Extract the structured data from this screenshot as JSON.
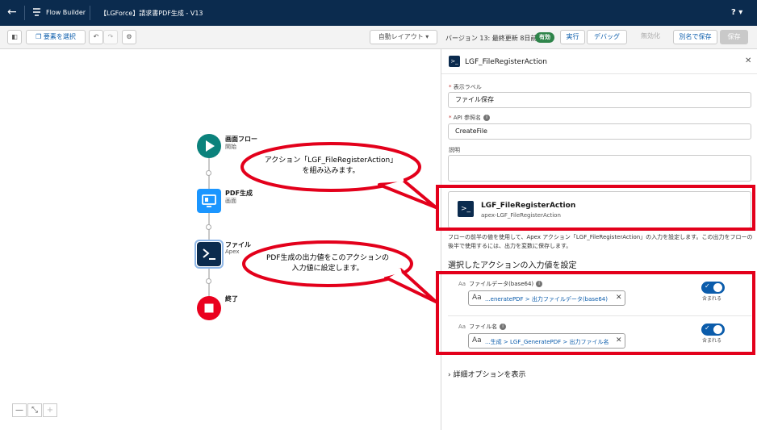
{
  "topbar": {
    "back_icon": "arrow-left-icon",
    "app_name": "Flow Builder",
    "flow_title": "【LGForce】請求書PDF生成 - V13",
    "help_label": "? ▾"
  },
  "toolbar": {
    "select_elements_label": "要素を選択",
    "auto_layout_label": "自動レイアウト ▾",
    "version_text": "バージョン 13: 最終更新 8日前",
    "active_badge": "有効",
    "run_label": "実行",
    "debug_label": "デバッグ",
    "deactivate_label": "無効化",
    "save_as_label": "別名で保存",
    "save_label": "保存"
  },
  "canvas": {
    "nodes": [
      {
        "title": "画面フロー",
        "subtitle": "開始"
      },
      {
        "title": "PDF生成",
        "subtitle": "画面"
      },
      {
        "title": "ファイル",
        "subtitle": "Apex"
      },
      {
        "title": "終了",
        "subtitle": ""
      }
    ],
    "zoom_out": "—",
    "fit": "⤡",
    "zoom_in": "+"
  },
  "panel": {
    "title": "LGF_FileRegisterAction",
    "close_icon": "✕",
    "label_field": {
      "label": "表示ラベル",
      "value": "ファイル保存"
    },
    "api_field": {
      "label": "API 参照名",
      "value": "CreateFile"
    },
    "description_field": {
      "label": "説明",
      "value": ""
    },
    "action": {
      "name": "LGF_FileRegisterAction",
      "api": "apex-LGF_FileRegisterAction"
    },
    "description_text": "フローの前半の値を使用して、Apex アクション「LGF_FileRegisterAction」の入力を設定します。この出力をフローの後半で使用するには、出力を変数に保存します。",
    "section_title": "選択したアクションの入力値を設定",
    "params": [
      {
        "label": "ファイルデータ(base64)",
        "value": "...eneratePDF > 出力ファイルデータ(base64)",
        "toggle_label": "含まれる",
        "included": true
      },
      {
        "label": "ファイル名",
        "value": "...生成 > LGF_GeneratePDF > 出力ファイル名",
        "toggle_label": "含まれる",
        "included": true
      }
    ],
    "advanced_label": "詳細オプションを表示"
  },
  "annotations": {
    "callout1": [
      "アクション「LGF_FileRegisterAction」",
      "を組み込みます。"
    ],
    "callout2": [
      "PDF生成の出力値をこのアクションの",
      "入力値に設定します。"
    ]
  },
  "colors": {
    "header_bg": "#0b2b4e",
    "accent": "#0b5cab",
    "active_green": "#2e844a",
    "start_node": "#0b827c",
    "screen_node": "#1b96ff",
    "apex_node": "#0b2b4e",
    "end_node": "#ea001e",
    "annotation_red": "#e3001b"
  }
}
